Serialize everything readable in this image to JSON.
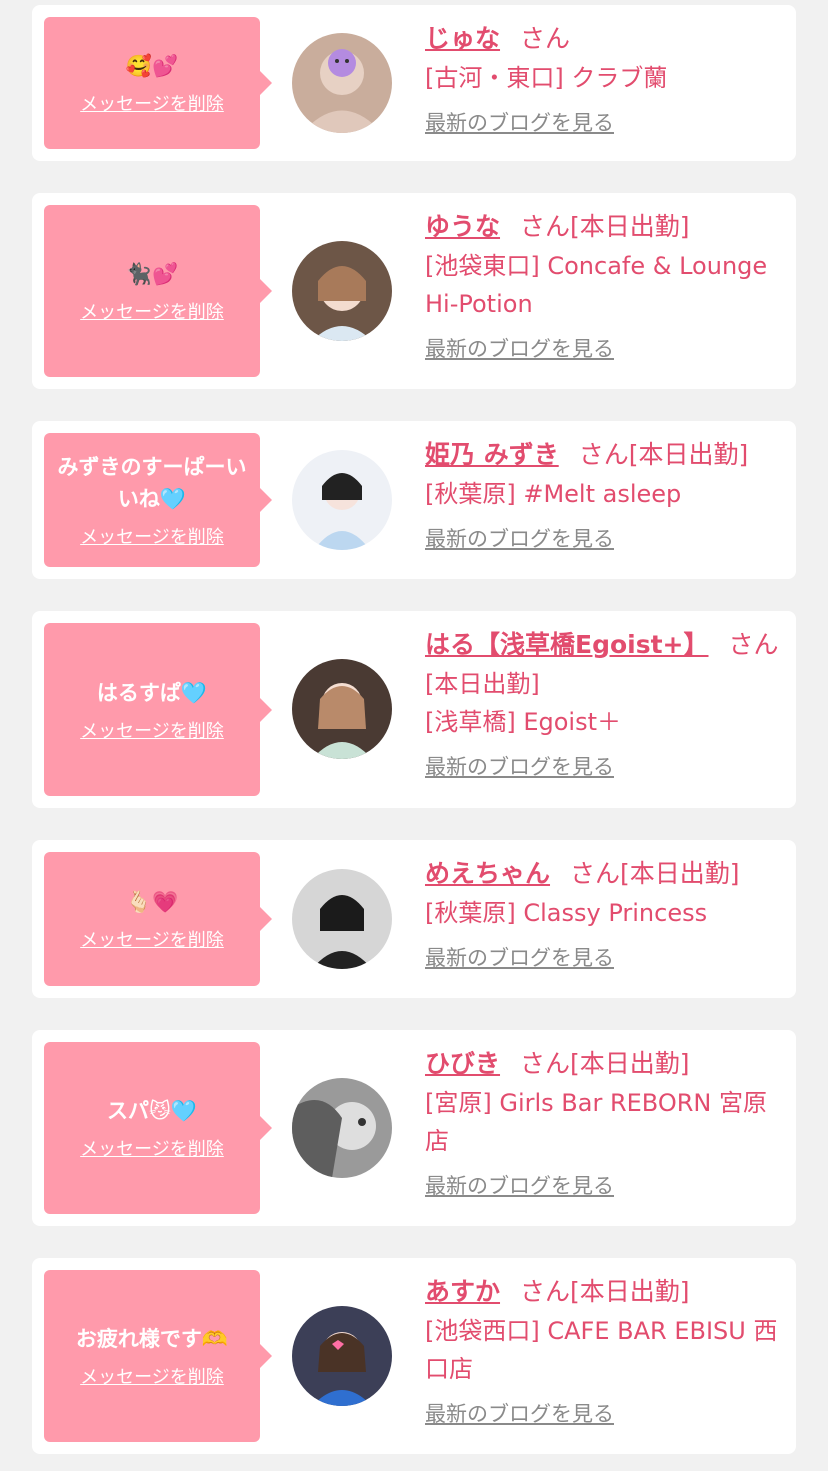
{
  "delete_label": "メッセージを削除",
  "blog_label": "最新のブログを見る",
  "honorific": "さん",
  "colors": {
    "accent": "#e24c6e",
    "bubble": "#ff9aab",
    "link_gray": "#8a8a8a"
  },
  "items": [
    {
      "message": "🥰💕",
      "name": "じゅな",
      "status": "",
      "shop": "[古河・東口] クラブ蘭"
    },
    {
      "message": "🐈‍⬛💕",
      "name": "ゆうな",
      "status": "[本日出勤]",
      "shop": "[池袋東口] Concafe & Lounge Hi-Potion"
    },
    {
      "message": "みずきのすーぱーいいね🩵",
      "name": "姫乃 みずき",
      "status": "[本日出勤]",
      "shop": "[秋葉原] #Melt asleep"
    },
    {
      "message": "はるすぱ🩵",
      "name": "はる【浅草橋Egoist+】",
      "status": "[本日出勤]",
      "shop": "[浅草橋] Egoist＋"
    },
    {
      "message": "🫰🏻💗",
      "name": "めえちゃん",
      "status": "[本日出勤]",
      "shop": "[秋葉原] Classy Princess"
    },
    {
      "message": "スパ😼🩵",
      "name": "ひびき",
      "status": "[本日出勤]",
      "shop": "[宮原] Girls Bar REBORN 宮原店"
    },
    {
      "message": "お疲れ様です🫶",
      "name": "あすか",
      "status": "[本日出勤]",
      "shop": "[池袋西口] CAFE BAR EBISU 西口店"
    }
  ]
}
